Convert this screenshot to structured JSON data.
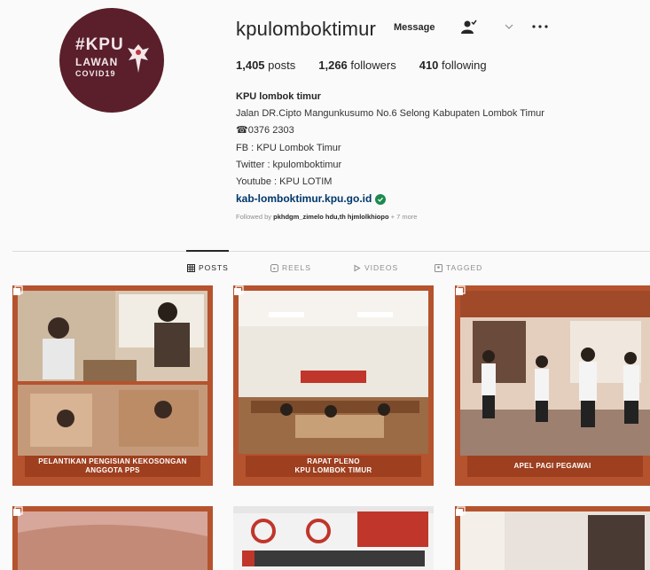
{
  "profile": {
    "username": "kpulomboktimur",
    "message_label": "Message",
    "stats": [
      {
        "value": "1,405",
        "label": "posts"
      },
      {
        "value": "1,266",
        "label": "followers"
      },
      {
        "value": "410",
        "label": "following"
      }
    ],
    "avatar": {
      "line1": "#KPU",
      "line2": "LAWAN",
      "line3": "COVID19"
    },
    "bio": {
      "name": "KPU lombok timur",
      "address": "Jalan DR.Cipto Mangunkusumo No.6 Selong Kabupaten Lombok Timur",
      "phone": "☎0376 2303",
      "fb": "FB : KPU Lombok Timur",
      "twitter": "Twitter : kpulomboktimur",
      "youtube": "Youtube : KPU LOTIM",
      "link": "kab-lomboktimur.kpu.go.id"
    },
    "followed_prefix": "Followed by",
    "followed_names": "pkhdgm_zimelo  hdu,th  hjmlolkhiopo",
    "followed_suffix": "+ 7 more"
  },
  "tabs": [
    {
      "label": "POSTS",
      "active": true
    },
    {
      "label": "REELS",
      "active": false
    },
    {
      "label": "VIDEOS",
      "active": false
    },
    {
      "label": "TAGGED",
      "active": false
    }
  ],
  "posts": [
    {
      "caption_line1": "PELANTIKAN PENGISIAN KEKOSONGAN",
      "caption_line2": "ANGGOTA PPS"
    },
    {
      "caption_line1": "RAPAT PLENO",
      "caption_line2": "KPU LOMBOK TIMUR"
    },
    {
      "caption_line1": "APEL PAGI PEGAWAI",
      "caption_line2": ""
    },
    {
      "caption_line1": "",
      "caption_line2": ""
    },
    {
      "caption_line1": "",
      "caption_line2": ""
    },
    {
      "caption_line1": "",
      "caption_line2": ""
    }
  ],
  "colors": {
    "avatar_bg": "#5a1f2b",
    "post_frame": "#b5532e",
    "link": "#00376b",
    "verified": "#1d8a4e"
  }
}
